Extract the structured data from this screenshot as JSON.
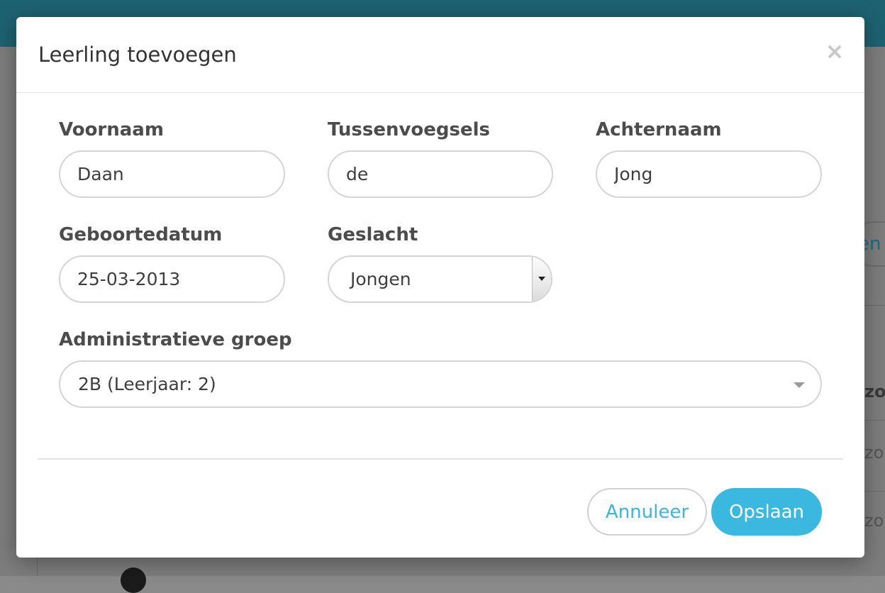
{
  "background": {
    "right_button_partial": "en",
    "row_texts": [
      "zor",
      "zor",
      "zor"
    ]
  },
  "modal": {
    "title": "Leerling toevoegen",
    "close_symbol": "×",
    "fields": {
      "first_name": {
        "label": "Voornaam",
        "value": "Daan"
      },
      "infix": {
        "label": "Tussenvoegsels",
        "value": "de"
      },
      "last_name": {
        "label": "Achternaam",
        "value": "Jong"
      },
      "birthdate": {
        "label": "Geboortedatum",
        "value": "25-03-2013"
      },
      "gender": {
        "label": "Geslacht",
        "selected": "Jongen"
      },
      "group": {
        "label": "Administratieve groep",
        "selected": "2B (Leerjaar: 2)"
      }
    },
    "buttons": {
      "cancel": "Annuleer",
      "save": "Opslaan"
    }
  },
  "colors": {
    "accent": "#3bb8e0",
    "topbar": "#1d6271"
  }
}
